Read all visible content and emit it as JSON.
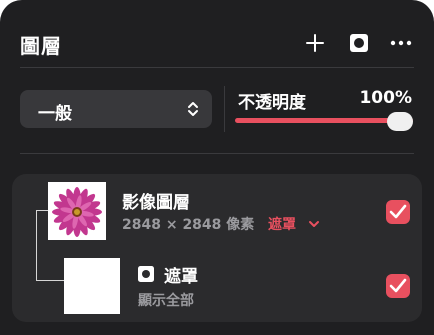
{
  "header": {
    "title": "圖層",
    "icons": [
      "add-icon",
      "mask-icon",
      "more-icon"
    ]
  },
  "blend": {
    "value": "一般"
  },
  "opacity": {
    "label": "不透明度",
    "value_label": "100%",
    "value": 1.0
  },
  "layers": [
    {
      "name": "影像圖層",
      "meta": "2848 × 2848 像素",
      "mask_link": "遮罩",
      "checked": true
    },
    {
      "name": "遮罩",
      "sub": "顯示全部",
      "checked": true
    }
  ],
  "colors": {
    "accent": "#e8505f",
    "panel": "#1f1f21",
    "card": "#2b2b2d"
  }
}
